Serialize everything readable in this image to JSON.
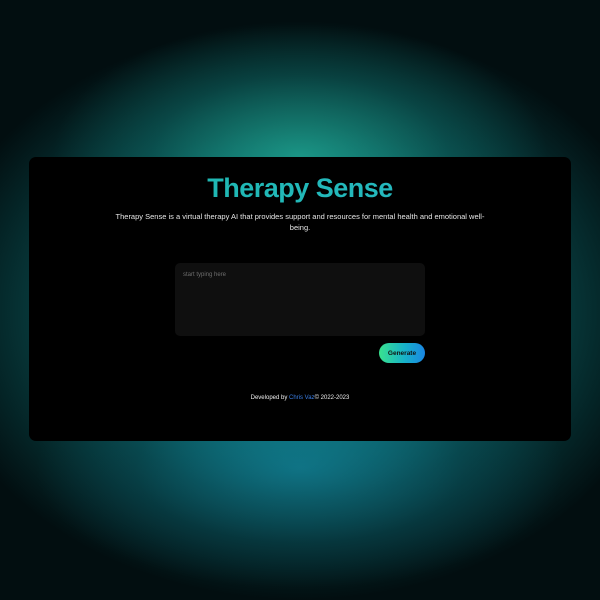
{
  "app": {
    "title": "Therapy Sense",
    "description": "Therapy Sense is a virtual therapy AI that provides support and resources for mental health and emotional well-being."
  },
  "prompt": {
    "value": "",
    "placeholder": "start typing here"
  },
  "actions": {
    "generate_label": "Generate"
  },
  "footer": {
    "prefix": "Developed by ",
    "author": "Chris Vaz",
    "suffix": "© 2022-2023"
  },
  "colors": {
    "background_teal": "#0e9696",
    "card": "#000000",
    "title_gradient_start": "#19b9a8",
    "title_gradient_end": "#2bb7c9",
    "button_gradient_start": "#39e28e",
    "button_gradient_end": "#1a86e3",
    "link": "#3a7ee6"
  }
}
